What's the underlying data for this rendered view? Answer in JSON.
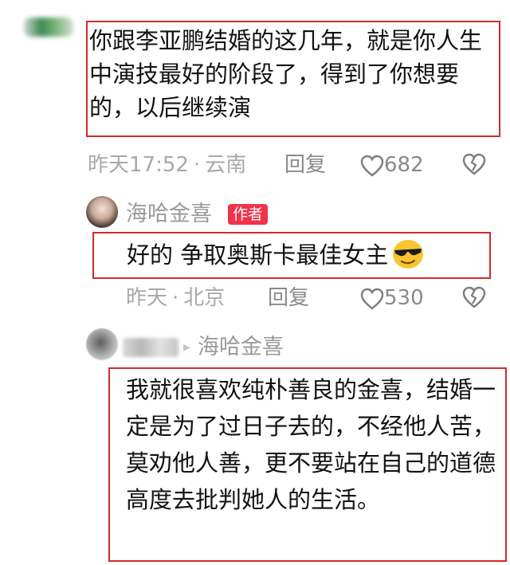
{
  "comments": [
    {
      "text": "你跟李亚鹏结婚的这几年，就是你人生中演技最好的阶段了，得到了你想要的，以后继续演",
      "time": "昨天17:52",
      "sep": "·",
      "location": "云南",
      "reply_label": "回复",
      "likes": "682"
    },
    {
      "username": "海哈金喜",
      "badge": "作者",
      "text": "好的 争取奥斯卡最佳女主",
      "emoji": "sunglasses-emoji",
      "time": "昨天",
      "sep": "·",
      "location": "北京",
      "reply_label": "回复",
      "likes": "530"
    },
    {
      "reply_arrow": "▸",
      "reply_to": "海哈金喜",
      "text": "我就很喜欢纯朴善良的金喜，结婚一定是为了过日子去的，不经他人苦，莫劝他人善，更不要站在自己的道德高度去批判她人的生活。"
    }
  ],
  "colors": {
    "highlight_border": "#d42a2a",
    "badge_bg": "#f2324a",
    "meta_text": "#a8a8a8"
  }
}
